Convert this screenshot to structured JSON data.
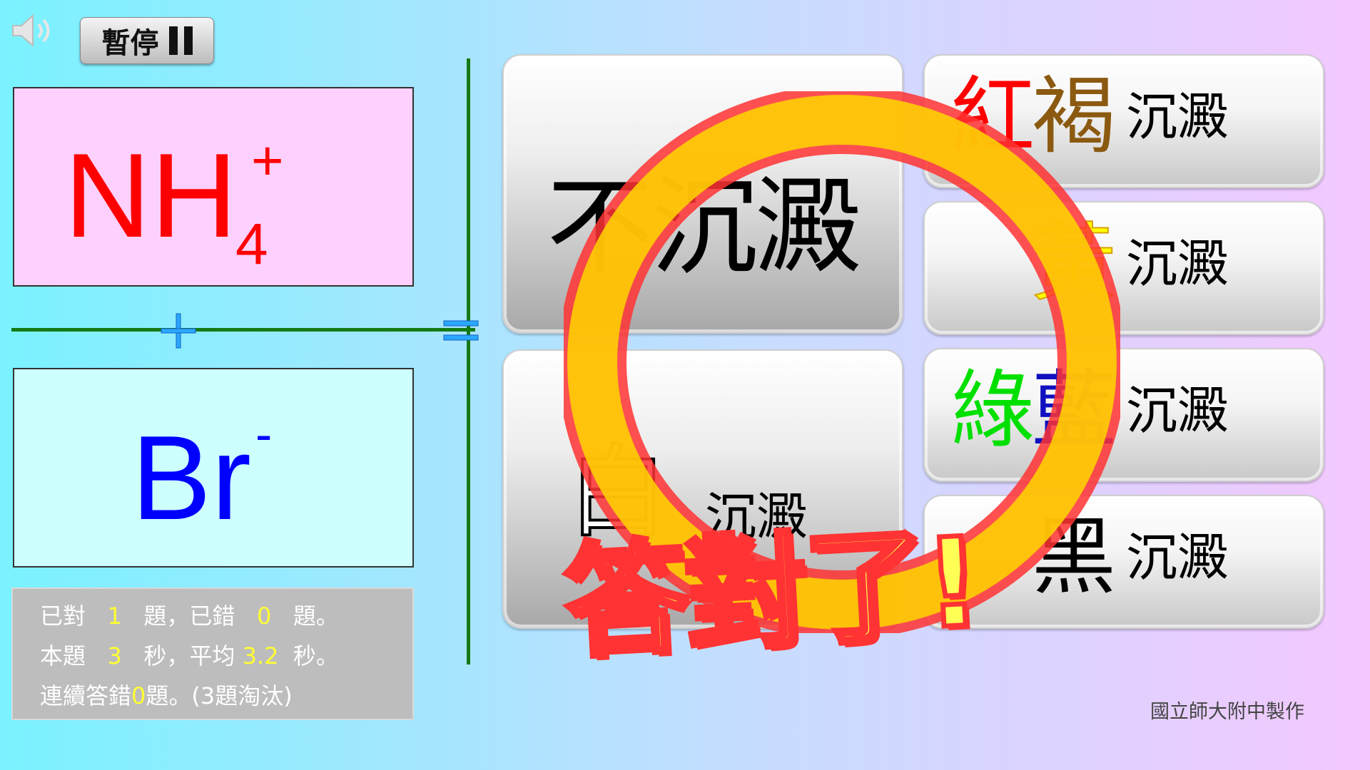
{
  "toolbar": {
    "pause_label": "暫停",
    "sound_icon": "speaker-icon"
  },
  "cation": {
    "symbol": "NH",
    "subscript": "4",
    "charge": "+",
    "color": "#ff0000"
  },
  "anion": {
    "symbol": "Br",
    "charge": "-",
    "color": "#0000ff"
  },
  "operators": {
    "plus": "+",
    "equals": "="
  },
  "stats": {
    "line1": [
      "已對",
      "1",
      "題，已錯",
      "0",
      "題。"
    ],
    "line2": [
      "本題",
      "3",
      "秒，平均",
      "3.2",
      "秒。"
    ],
    "line3": [
      "連續答錯",
      "0",
      "題。(3題淘汰)"
    ]
  },
  "answers": {
    "no_precipitate": "不沉澱",
    "white": {
      "color_word": "白",
      "suffix": "沉澱"
    },
    "red_brown": {
      "c1": "紅",
      "c2": "褐",
      "suffix": "沉澱"
    },
    "yellow": {
      "color_word": "黃",
      "suffix": "沉澱"
    },
    "green_blue": {
      "c1": "綠",
      "c2": "藍",
      "suffix": "沉澱"
    },
    "black": {
      "color_word": "黑",
      "suffix": "沉澱"
    }
  },
  "feedback": {
    "message": "答對了!"
  },
  "credit": "國立師大附中製作",
  "colors": {
    "red": "#ff0000",
    "brown": "#8b5a10",
    "yellow": "#ffff00",
    "green": "#00e000",
    "blue": "#1010c0",
    "ring_outer": "#ff3333",
    "ring_fill": "#ffd700"
  }
}
